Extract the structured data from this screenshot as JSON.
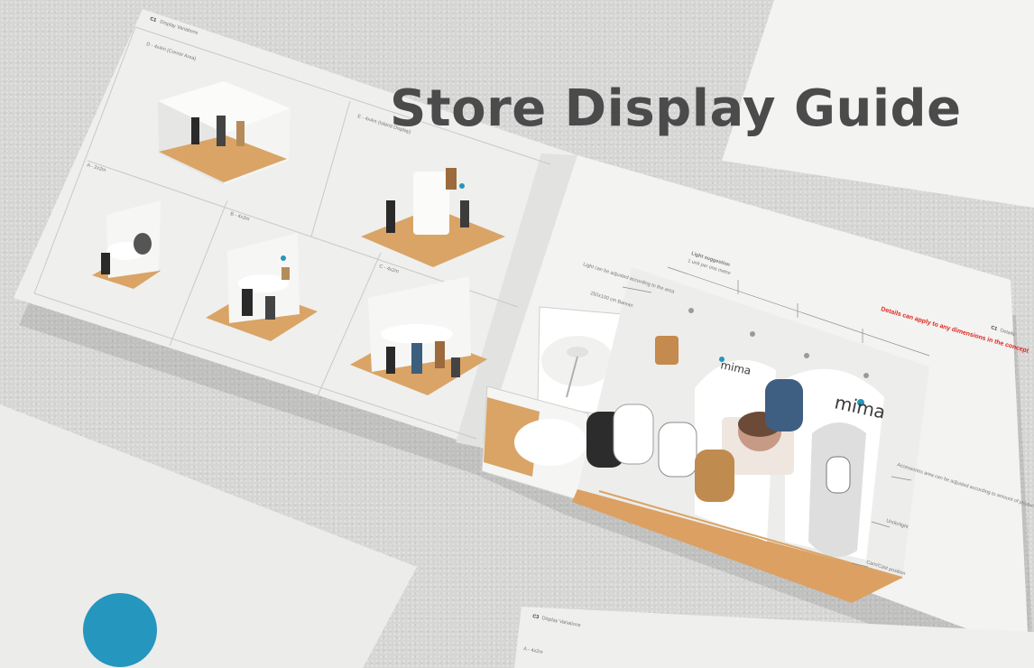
{
  "page": {
    "title": "Store Display Guide"
  },
  "left_page": {
    "section": "C1",
    "section_title": "Display Variations",
    "panels": [
      {
        "label": "D - 4x4m (Corner Area)"
      },
      {
        "label": "E - 4x4m (Island Display)"
      },
      {
        "label": "A - 2x2m"
      },
      {
        "label": "B - 4x2m"
      },
      {
        "label": "C - 4x2m"
      }
    ]
  },
  "right_page": {
    "section": "C1",
    "section_title": "Details",
    "callout_red": "Details can apply to any dimensions in the concept",
    "annotations": {
      "light_suggestion": "Light suggestion",
      "light_sub": "1 unit per one metre",
      "light_adjust": "Light can be adjusted according to the area",
      "banner": "250x100 cm Banner",
      "accessories": "Accessories area can be adjusted according to amount of products",
      "underlight": "Underlight",
      "cam_position": "Cam/Cast position"
    },
    "brand": "mima"
  },
  "bottom_page": {
    "section": "C3",
    "section_title": "Display Variations",
    "panel_label": "A - 4x2m"
  },
  "colors": {
    "accent_blue": "#2596be",
    "title_gray": "#4b4b4b",
    "red": "#e0251b",
    "wood": "#d9a466",
    "background": "#d6d6d5"
  }
}
